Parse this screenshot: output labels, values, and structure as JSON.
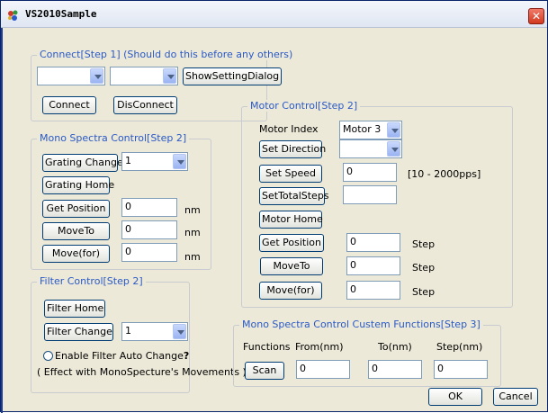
{
  "window": {
    "title": "VS2010Sample",
    "close_glyph": "✕"
  },
  "connect": {
    "legend": "Connect[Step 1] (Should do this before any others)",
    "port_value": "",
    "baud_value": "",
    "show_setting_label": "ShowSettingDialog",
    "connect_label": "Connect",
    "disconnect_label": "DisConnect"
  },
  "mono": {
    "legend": "Mono Spectra Control[Step 2]",
    "grating_change_label": "Grating Change",
    "grating_value": "1",
    "grating_home_label": "Grating Home",
    "get_position_label": "Get Position",
    "get_position_value": "0",
    "moveto_label": "MoveTo",
    "moveto_value": "0",
    "movefor_label": "Move(for)",
    "movefor_value": "0",
    "unit": "nm"
  },
  "filter": {
    "legend": "Filter Control[Step 2]",
    "home_label": "Filter Home",
    "change_label": "Filter Change",
    "change_value": "1",
    "auto_label": "Enable Filter Auto Change",
    "auto_q": "?",
    "note": "( Effect with MonoSpecture's Movements )"
  },
  "motor": {
    "legend": "Motor Control[Step 2]",
    "index_label": "Motor Index",
    "index_value": "Motor 3",
    "set_direction_label": "Set Direction",
    "direction_value": "",
    "set_speed_label": "Set Speed",
    "speed_value": "0",
    "speed_range": "[10 - 2000pps]",
    "set_total_label": "SetTotalSteps",
    "total_value": "",
    "home_label": "Motor Home",
    "get_position_label": "Get Position",
    "get_position_value": "0",
    "moveto_label": "MoveTo",
    "moveto_value": "0",
    "movefor_label": "Move(for)",
    "movefor_value": "0",
    "unit": "Step"
  },
  "custom": {
    "legend": "Mono Spectra Control Custem Functions[Step 3]",
    "functions_label": "Functions",
    "from_label": "From(nm)",
    "to_label": "To(nm)",
    "step_label": "Step(nm)",
    "scan_label": "Scan",
    "from_value": "0",
    "to_value": "0",
    "step_value": "0"
  },
  "footer": {
    "ok_label": "OK",
    "cancel_label": "Cancel"
  },
  "icons": {
    "app": "app-icon",
    "close": "close-icon",
    "dropdown": "chevron-down-icon",
    "radio": "radio-icon"
  }
}
